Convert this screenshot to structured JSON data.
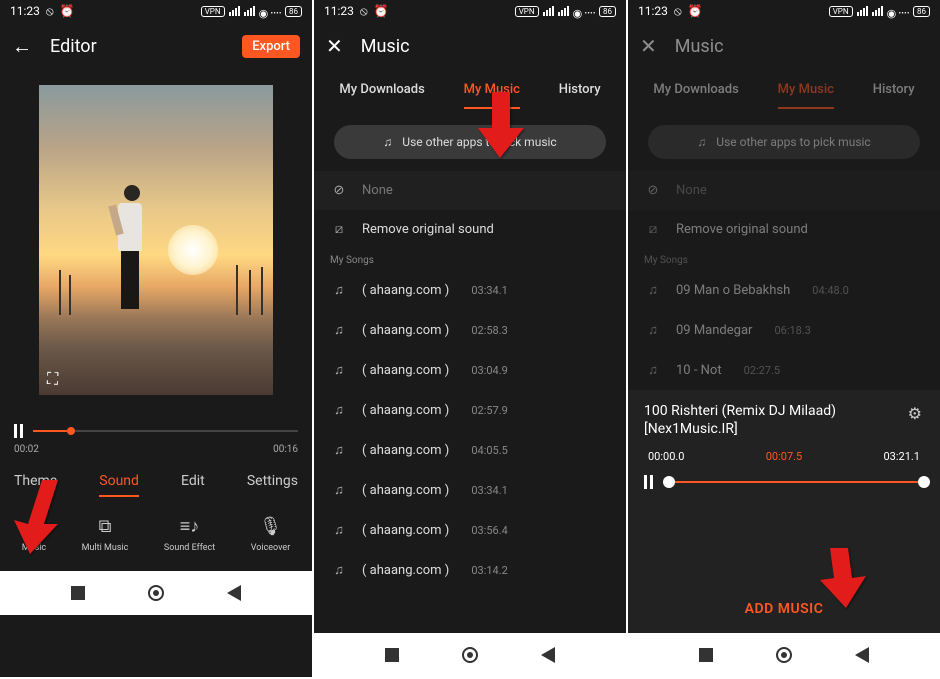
{
  "status": {
    "time": "11:23",
    "vpn": "VPN",
    "battery": "86"
  },
  "screen1": {
    "title": "Editor",
    "export_label": "Export",
    "time_current": "00:02",
    "time_total": "00:16",
    "tabs": [
      "Theme",
      "Sound",
      "Edit",
      "Settings"
    ],
    "active_tab_index": 1,
    "tools": [
      {
        "label": "Music"
      },
      {
        "label": "Multi Music"
      },
      {
        "label": "Sound Effect"
      },
      {
        "label": "Voiceover"
      }
    ]
  },
  "screen2": {
    "title": "Music",
    "tabs": [
      "My Downloads",
      "My Music",
      "History"
    ],
    "active_tab_index": 1,
    "use_other_label": "Use other apps to pick music",
    "none_label": "None",
    "remove_label": "Remove original sound",
    "section_label": "My Songs",
    "songs": [
      {
        "name": "( ahaang.com )",
        "dur": "03:34.1"
      },
      {
        "name": "( ahaang.com )",
        "dur": "02:58.3"
      },
      {
        "name": "( ahaang.com )",
        "dur": "03:04.9"
      },
      {
        "name": "( ahaang.com )",
        "dur": "02:57.9"
      },
      {
        "name": "( ahaang.com )",
        "dur": "04:05.5"
      },
      {
        "name": "( ahaang.com )",
        "dur": "03:34.1"
      },
      {
        "name": "( ahaang.com )",
        "dur": "03:56.4"
      },
      {
        "name": "( ahaang.com )",
        "dur": "03:14.2"
      }
    ]
  },
  "screen3": {
    "title": "Music",
    "tabs": [
      "My Downloads",
      "My Music",
      "History"
    ],
    "active_tab_index": 1,
    "use_other_label": "Use other apps to pick music",
    "none_label": "None",
    "remove_label": "Remove original sound",
    "section_label": "My Songs",
    "songs": [
      {
        "name": "09 Man o Bebakhsh",
        "dur": "04:48.0"
      },
      {
        "name": "09 Mandegar",
        "dur": "06:18.3"
      },
      {
        "name": "10 - Not",
        "dur": "02:27.5"
      }
    ],
    "player": {
      "title": "100 Rishteri (Remix DJ Milaad) [Nex1Music.IR]",
      "time_start": "00:00.0",
      "time_mid": "00:07.5",
      "time_end": "03:21.1",
      "add_label": "ADD MUSIC"
    }
  }
}
